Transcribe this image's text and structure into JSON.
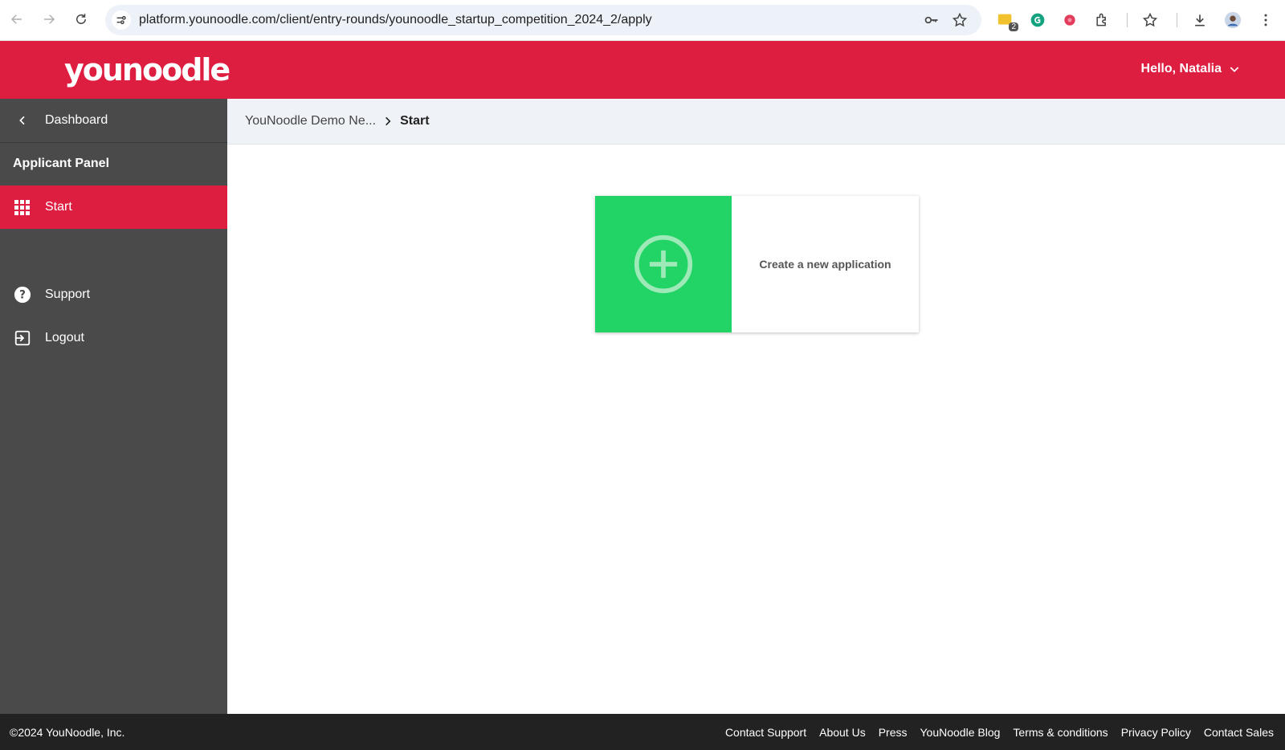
{
  "browser": {
    "url": "platform.younoodle.com/client/entry-rounds/younoodle_startup_competition_2024_2/apply",
    "extension_badge": "2"
  },
  "header": {
    "logo": "younoodle",
    "greeting": "Hello, Natalia",
    "brand_color": "#de1e41"
  },
  "sidebar": {
    "dashboard_label": "Dashboard",
    "panel_title": "Applicant Panel",
    "start_label": "Start",
    "support_label": "Support",
    "logout_label": "Logout"
  },
  "breadcrumb": {
    "parent": "YouNoodle Demo Ne...",
    "current": "Start"
  },
  "main": {
    "create_label": "Create a new application",
    "card_color": "#22d366"
  },
  "footer": {
    "copyright": "©2024 YouNoodle, Inc.",
    "links": [
      "Contact Support",
      "About Us",
      "Press",
      "YouNoodle Blog",
      "Terms & conditions",
      "Privacy Policy",
      "Contact Sales"
    ]
  }
}
